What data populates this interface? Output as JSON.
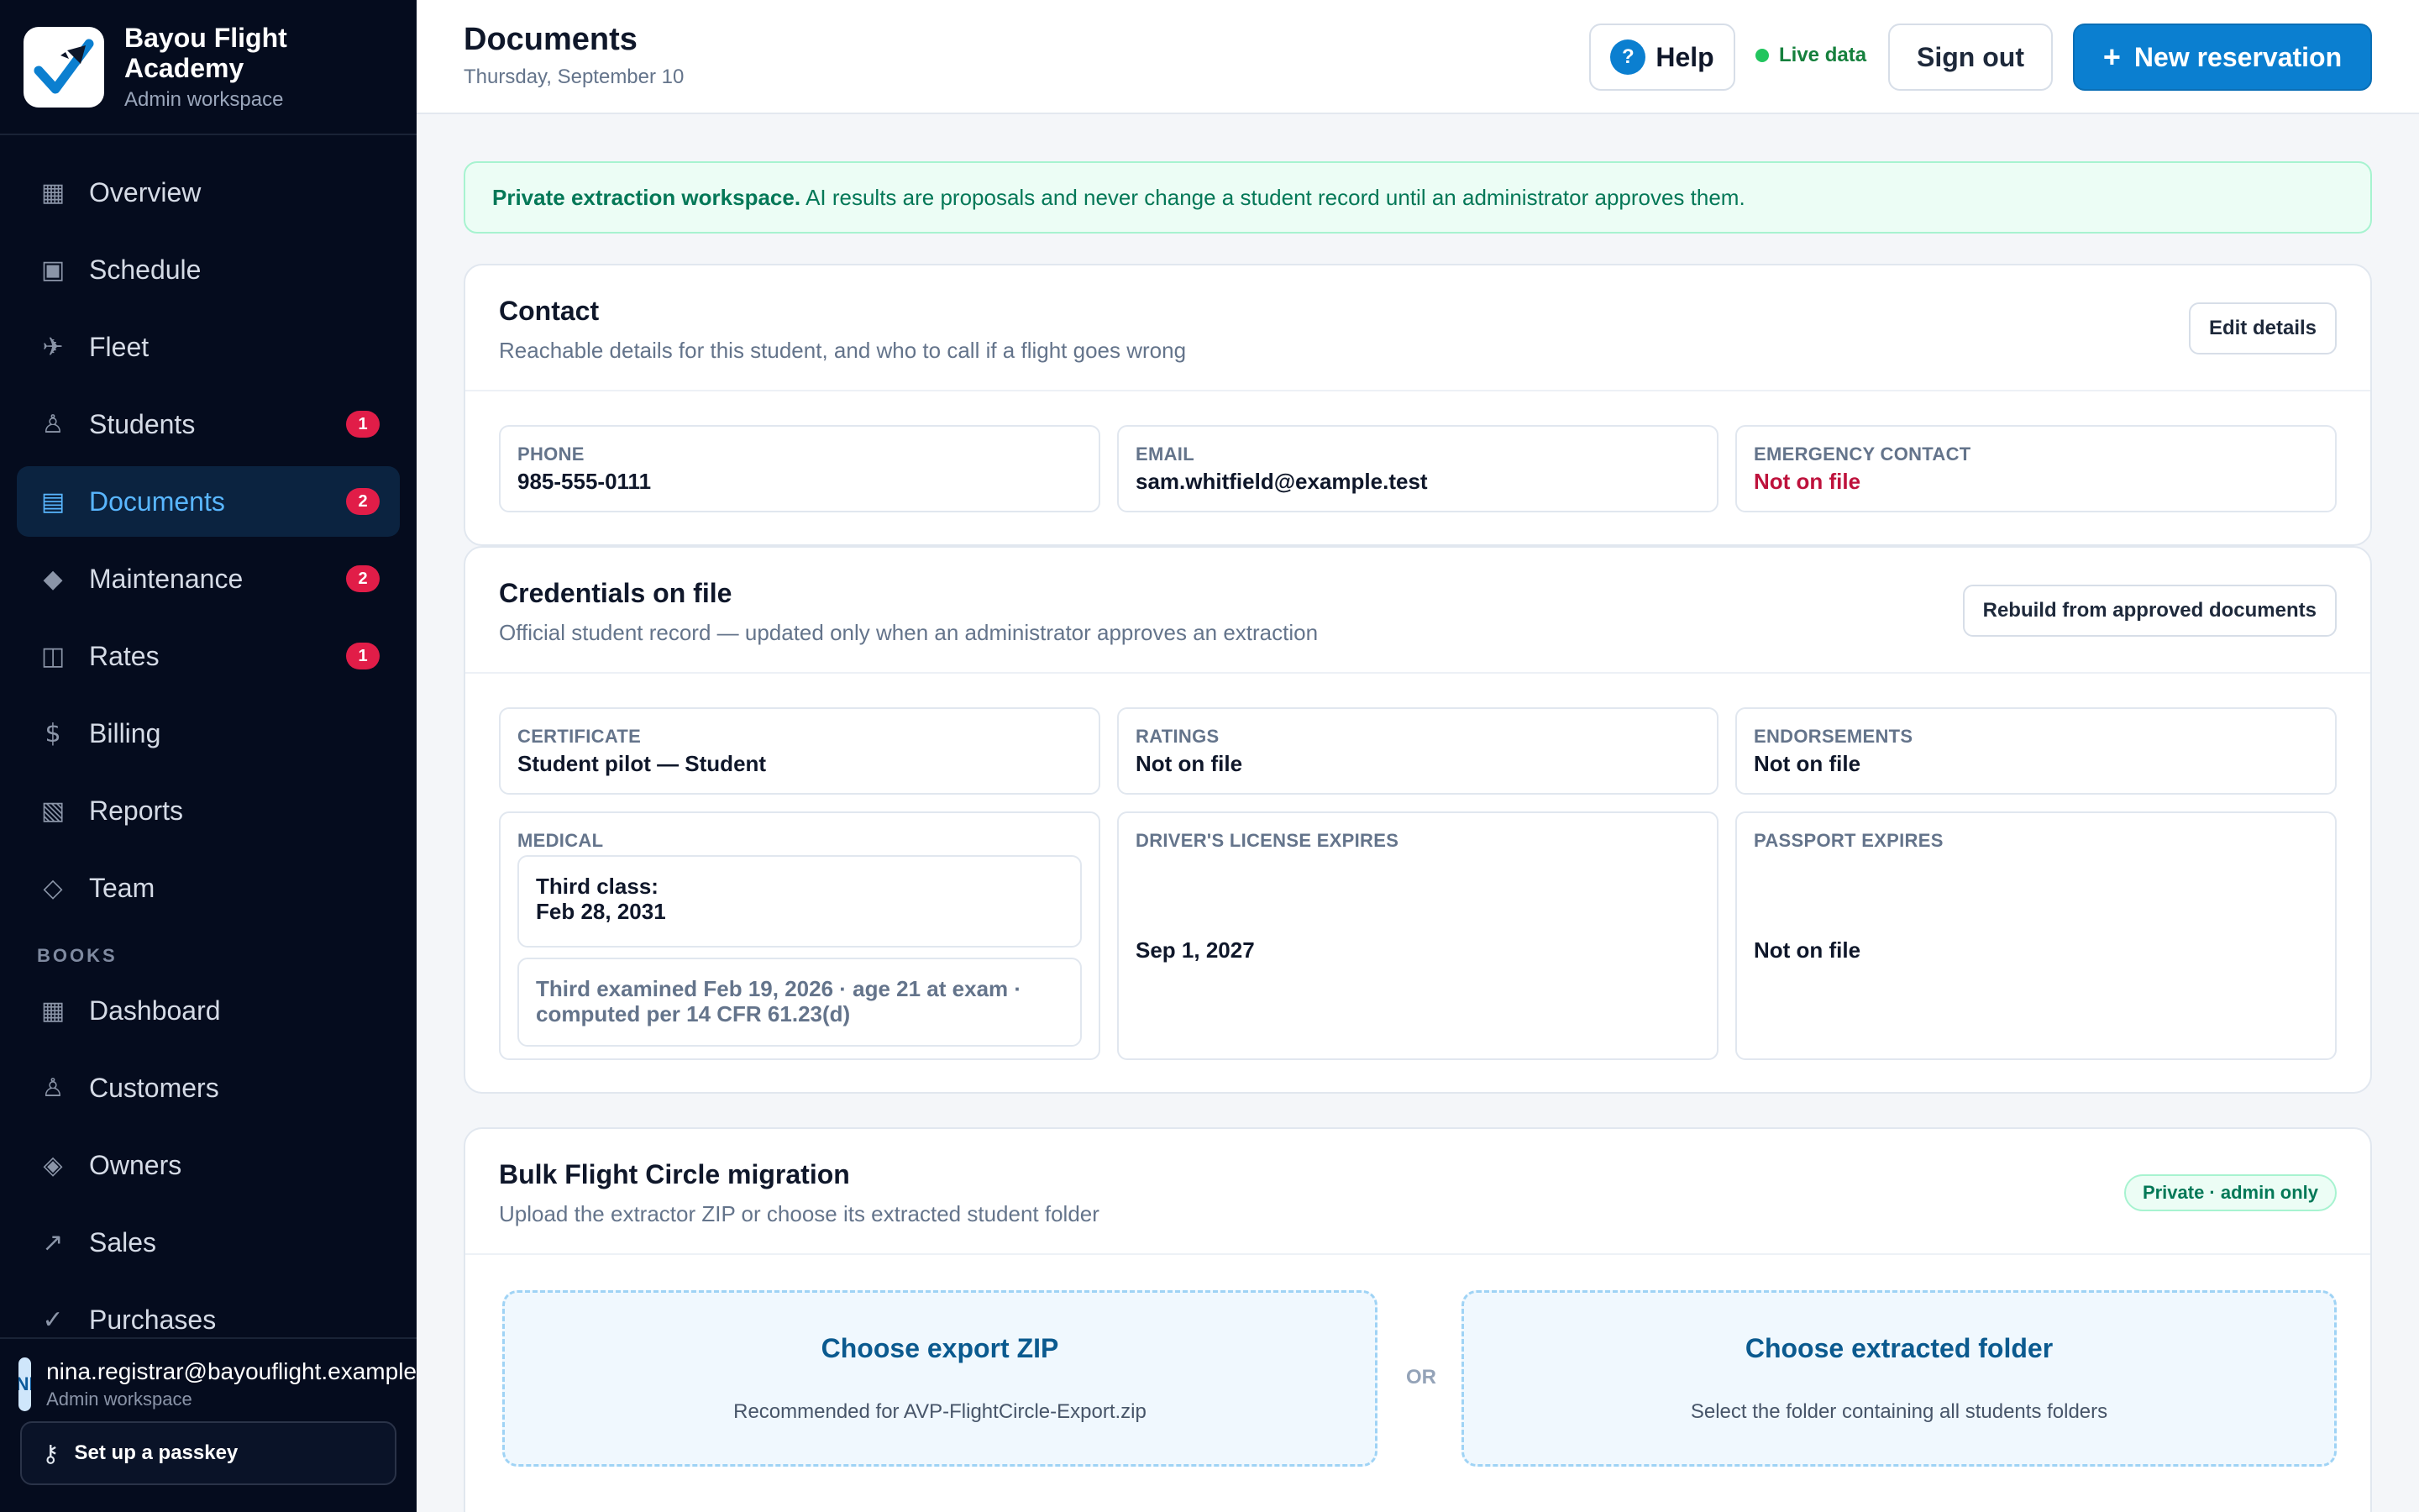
{
  "brand": {
    "name": "Bayou Flight Academy",
    "subtitle": "Admin workspace"
  },
  "nav": {
    "main": [
      {
        "label": "Overview",
        "icon": "grid-icon",
        "glyph": "▦",
        "badge": ""
      },
      {
        "label": "Schedule",
        "icon": "calendar-icon",
        "glyph": "▣",
        "badge": ""
      },
      {
        "label": "Fleet",
        "icon": "plane-icon",
        "glyph": "✈",
        "badge": ""
      },
      {
        "label": "Students",
        "icon": "person-icon",
        "glyph": "♙",
        "badge": "1"
      },
      {
        "label": "Documents",
        "icon": "document-icon",
        "glyph": "▤",
        "badge": "2"
      },
      {
        "label": "Maintenance",
        "icon": "wrench-icon",
        "glyph": "◆",
        "badge": "2"
      },
      {
        "label": "Rates",
        "icon": "rates-icon",
        "glyph": "◫",
        "badge": "1"
      },
      {
        "label": "Billing",
        "icon": "dollar-icon",
        "glyph": "$",
        "badge": ""
      },
      {
        "label": "Reports",
        "icon": "chart-icon",
        "glyph": "▧",
        "badge": ""
      },
      {
        "label": "Team",
        "icon": "team-icon",
        "glyph": "◇",
        "badge": ""
      }
    ],
    "books_section": "BOOKS",
    "books": [
      {
        "label": "Dashboard",
        "icon": "grid-icon",
        "glyph": "▦"
      },
      {
        "label": "Customers",
        "icon": "person-icon",
        "glyph": "♙"
      },
      {
        "label": "Owners",
        "icon": "diamond-icon",
        "glyph": "◈"
      },
      {
        "label": "Sales",
        "icon": "trend-up-icon",
        "glyph": "↗"
      },
      {
        "label": "Purchases",
        "icon": "check-icon",
        "glyph": "✓"
      }
    ],
    "active": "Documents"
  },
  "account": {
    "initials": "NI",
    "email": "nina.registrar@bayouflight.example",
    "role": "Admin workspace",
    "passkey_label": "Set up a passkey"
  },
  "header": {
    "title": "Documents",
    "date": "Thursday, September 10",
    "help_label": "Help",
    "live_label": "Live data",
    "signout_label": "Sign out",
    "new_label": "New reservation"
  },
  "notice": {
    "bold": "Private extraction workspace.",
    "text": "AI results are proposals and never change a student record until an administrator approves them."
  },
  "contact": {
    "title": "Contact",
    "subtitle": "Reachable details for this student, and who to call if a flight goes wrong",
    "edit_label": "Edit details",
    "phone_label": "PHONE",
    "phone": "985-555-0111",
    "email_label": "EMAIL",
    "email": "sam.whitfield@example.test",
    "emergency_label": "EMERGENCY CONTACT",
    "emergency": "Not on file"
  },
  "credentials": {
    "title": "Credentials on file",
    "subtitle": "Official student record — updated only when an administrator approves an extraction",
    "rebuild_label": "Rebuild from approved documents",
    "certificate_label": "CERTIFICATE",
    "certificate": "Student pilot — Student",
    "ratings_label": "RATINGS",
    "ratings": "Not on file",
    "endorsements_label": "ENDORSEMENTS",
    "endorsements": "Not on file",
    "medical_label": "MEDICAL",
    "medical_class": "Third class:",
    "medical_expiry": "Feb 28, 2031",
    "medical_note": "Third examined Feb 19, 2026 · age 21 at exam · computed per 14 CFR 61.23(d)",
    "license_label": "DRIVER'S LICENSE EXPIRES",
    "license": "Sep 1, 2027",
    "passport_label": "PASSPORT EXPIRES",
    "passport": "Not on file"
  },
  "migration": {
    "title": "Bulk Flight Circle migration",
    "subtitle": "Upload the extractor ZIP or choose its extracted student folder",
    "badge": "Private · admin only",
    "zip_title": "Choose export ZIP",
    "zip_sub": "Recommended for AVP-FlightCircle-Export.zip",
    "or_label": "OR",
    "folder_title": "Choose extracted folder",
    "folder_sub": "Select the folder containing all students folders"
  }
}
